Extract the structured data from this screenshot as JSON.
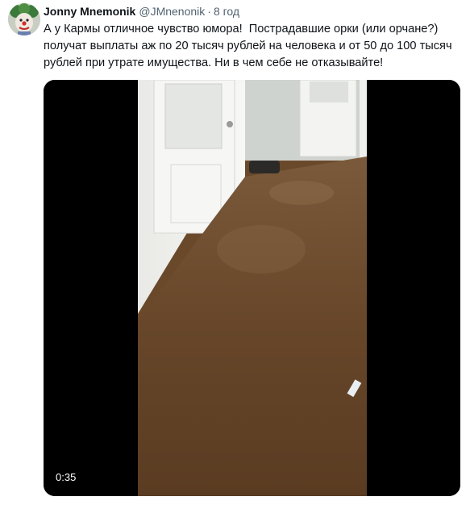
{
  "tweet": {
    "author": {
      "display_name": "Jonny Mnemonik",
      "handle": "@JMnenonik",
      "avatar_icon": "clown-avatar-icon"
    },
    "separator": "·",
    "time": "8 год",
    "text": "А у Кармы отличное чувство юмора!  Пострадавшие орки (или орчане?) получат выплаты аж по 20 тысяч рублей на человека и от 50 до 100 тысяч рублей при утрате имущества. Ни в чем себе не отказывайте!"
  },
  "video": {
    "duration": "0:35",
    "colors": {
      "floor_water": "#6b4a2c",
      "wall": "#f4f4f2",
      "frame": "#000000"
    }
  }
}
